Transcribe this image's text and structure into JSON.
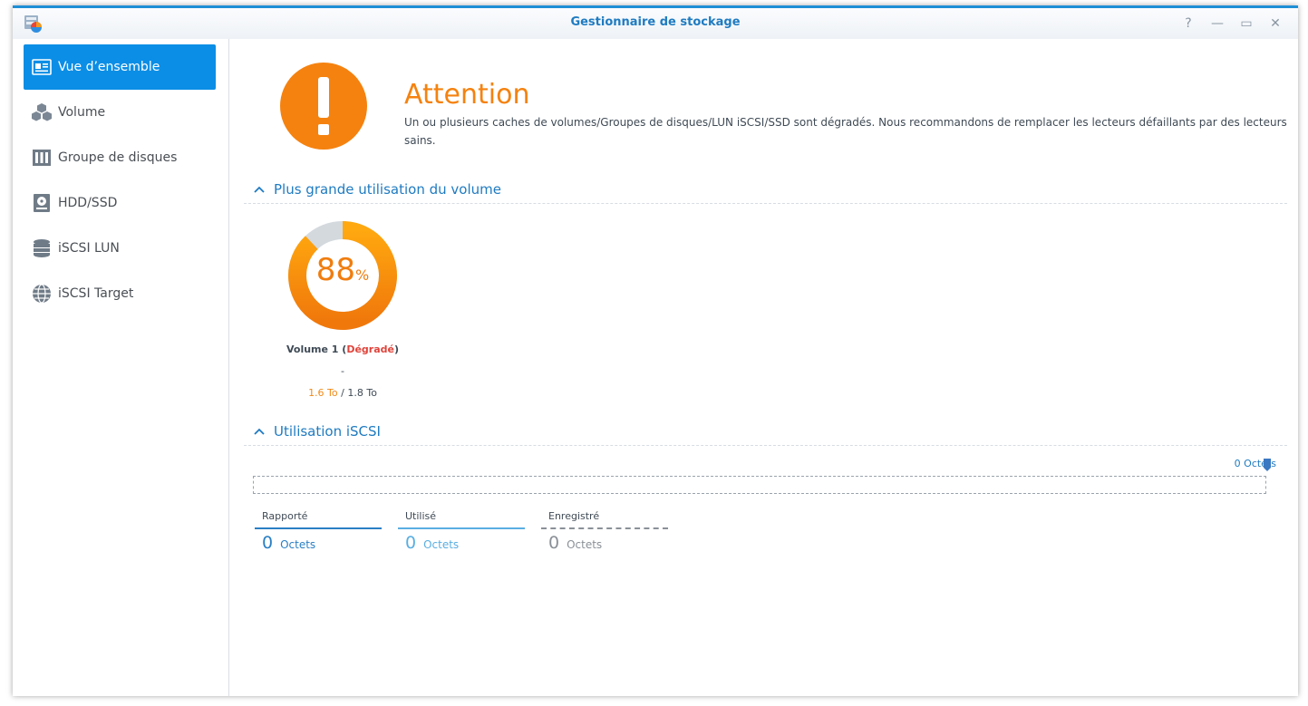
{
  "window": {
    "title": "Gestionnaire de stockage",
    "buttons": {
      "help": "?",
      "minimize": "—",
      "maximize": "▭",
      "close": "✕"
    }
  },
  "sidebar": {
    "items": [
      {
        "label": "Vue d’ensemble",
        "icon": "overview-icon",
        "active": true
      },
      {
        "label": "Volume",
        "icon": "volume-icon"
      },
      {
        "label": "Groupe de disques",
        "icon": "disk-group-icon"
      },
      {
        "label": "HDD/SSD",
        "icon": "hdd-icon"
      },
      {
        "label": "iSCSI LUN",
        "icon": "database-icon"
      },
      {
        "label": "iSCSI Target",
        "icon": "globe-icon"
      }
    ]
  },
  "status": {
    "title": "Attention",
    "description": "Un ou plusieurs caches de volumes/Groupes de disques/LUN iSCSI/SSD sont dégradés. Nous recommandons de remplacer les lecteurs défaillants par des lecteurs sains.",
    "icon": "warning-icon",
    "color": "#f5820f"
  },
  "volume_section": {
    "title": "Plus grande utilisation du volume",
    "usage_value": "88",
    "usage_unit": "%",
    "usage_fraction": 0.88,
    "volume_name": "Volume 1",
    "volume_open": "(",
    "volume_state": "Dégradé",
    "volume_close": ")",
    "dash": "-",
    "used": "1.6 To",
    "separator": "/",
    "total": "1.8 To"
  },
  "iscsi_section": {
    "title": "Utilisation iSCSI",
    "top_value": "0 Octets",
    "stats": [
      {
        "label": "Rapporté",
        "value": "0",
        "unit": "Octets",
        "color": "#2a7fc4"
      },
      {
        "label": "Utilisé",
        "value": "0",
        "unit": "Octets",
        "color": "#5aaee2"
      },
      {
        "label": "Enregistré",
        "value": "0",
        "unit": "Octets",
        "color": "#8a9097"
      }
    ]
  },
  "colors": {
    "accent": "#0b8ee6",
    "title_blue": "#1f7bc1",
    "warning": "#f5820f",
    "degraded": "#e0443b"
  }
}
